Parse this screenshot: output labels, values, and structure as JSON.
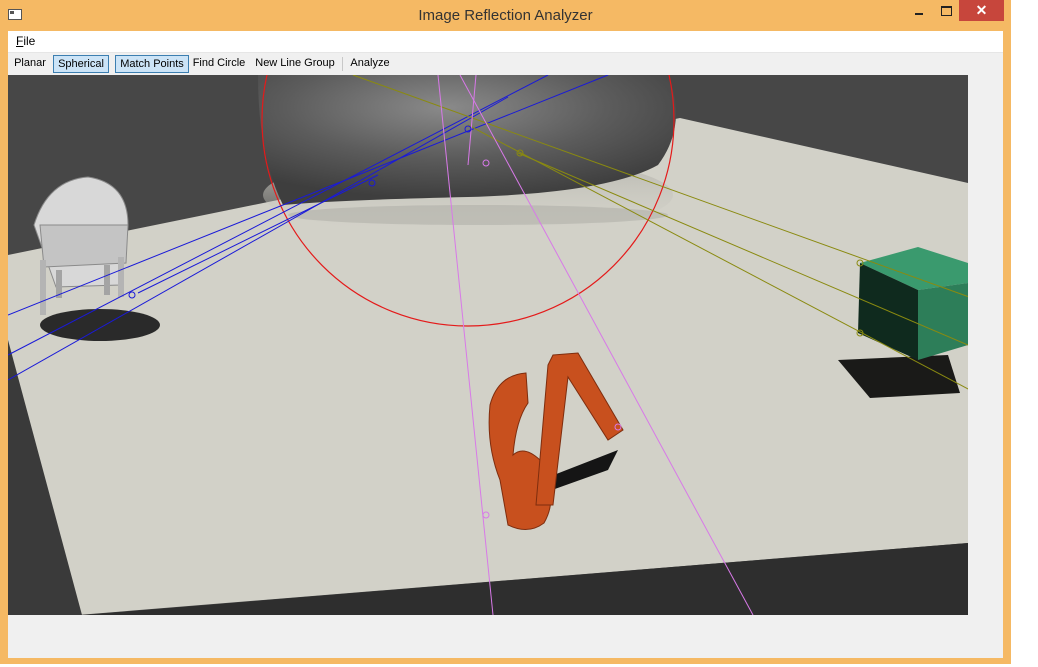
{
  "window": {
    "title": "Image Reflection Analyzer"
  },
  "titlebar_buttons": {
    "minimize_icon": "minimize-icon",
    "maximize_icon": "maximize-icon",
    "close_glyph": "✕"
  },
  "menu": {
    "file_mnemonic": "F",
    "file_rest": "ile"
  },
  "toolbar": {
    "planar": "Planar",
    "spherical": "Spherical",
    "match_points": "Match Points",
    "find_circle": "Find Circle",
    "new_line_group": "New Line Group",
    "analyze": "Analyze"
  },
  "toolbar_state": {
    "spherical_active": true,
    "match_points_active": true
  },
  "scene": {
    "letters": "6A",
    "colors": {
      "wall": "#474747",
      "floor": "#d2d1c8",
      "chair": "#d8d8d8",
      "cube": "#3a9a6e",
      "letters": "#c8501e",
      "circle": "#e41a1a",
      "blue_lines": "#1a1ad8",
      "olive_lines": "#8a8a10",
      "magenta_lines": "#d879e8"
    }
  }
}
